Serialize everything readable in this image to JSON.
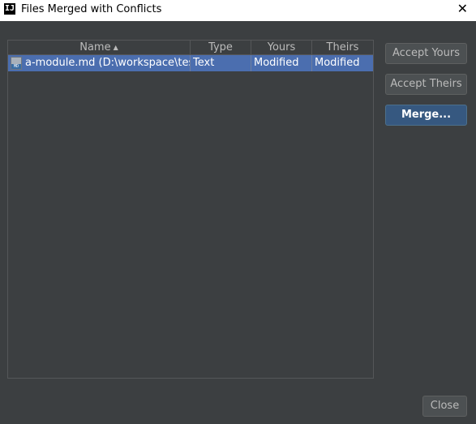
{
  "window": {
    "title": "Files Merged with Conflicts",
    "app_icon": "IJ",
    "close_glyph": "✕"
  },
  "table": {
    "columns": [
      "Name",
      "Type",
      "Yours",
      "Theirs"
    ],
    "sort": {
      "column": "Name",
      "direction": "ascending",
      "indicator": "▲"
    },
    "rows": [
      {
        "name": "a-module.md (D:\\workspace\\testgi",
        "type": "Text",
        "yours": "Modified",
        "theirs": "Modified",
        "icon": "md-file-icon",
        "selected": true
      }
    ]
  },
  "actions": {
    "accept_yours": "Accept Yours",
    "accept_theirs": "Accept Theirs",
    "merge": "Merge..."
  },
  "footer": {
    "close": "Close"
  },
  "colors": {
    "background": "#3c3f41",
    "selection": "#4b6eaf",
    "default_button": "#365880"
  }
}
